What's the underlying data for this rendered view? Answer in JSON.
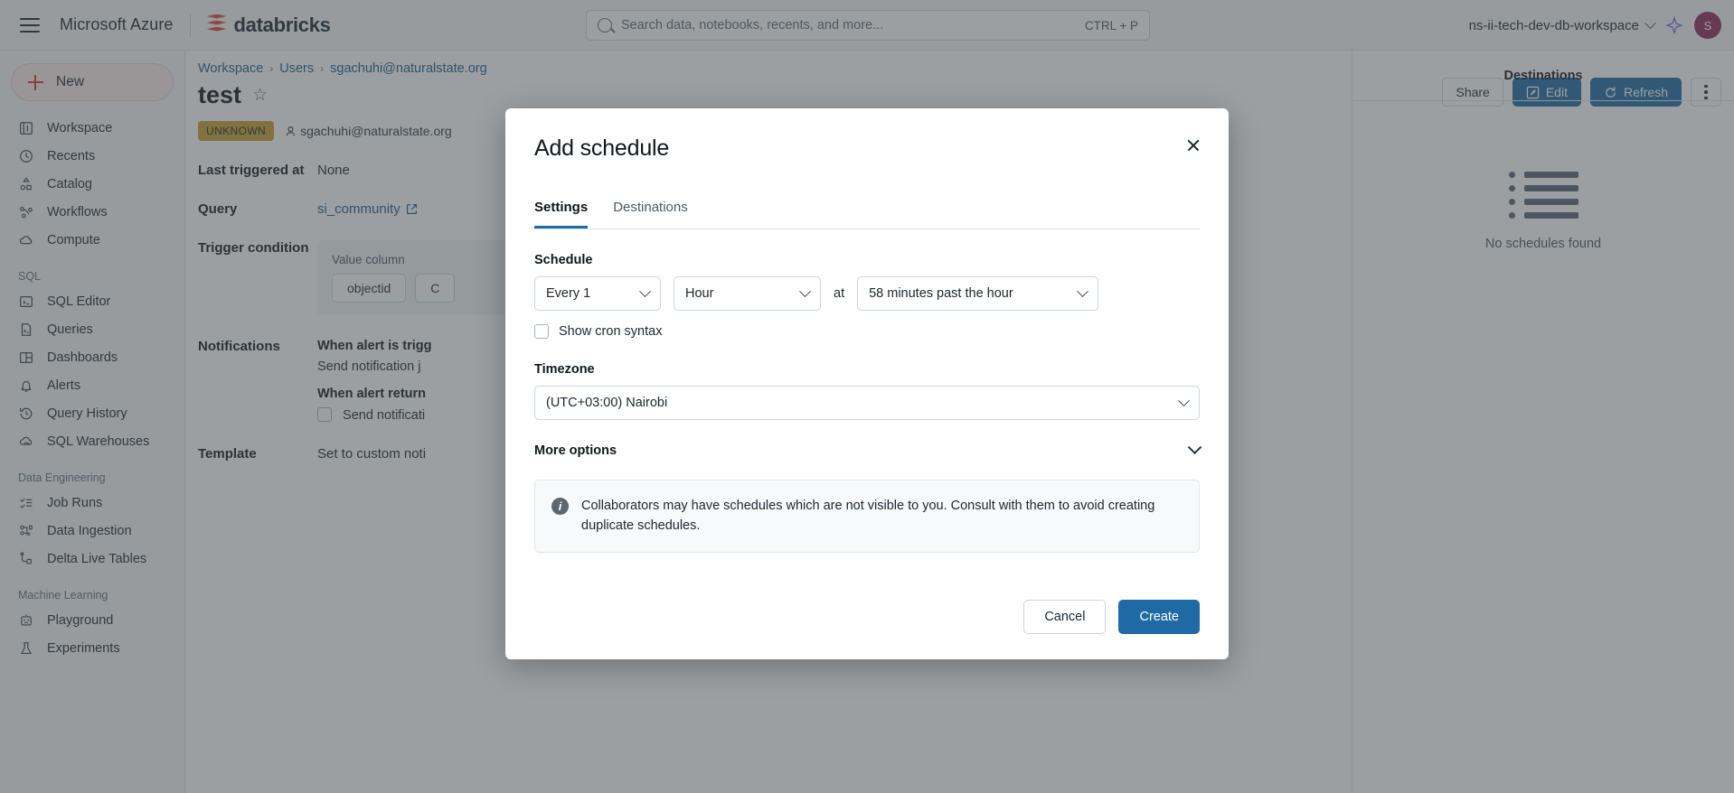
{
  "topbar": {
    "menu_icon": "hamburger-icon",
    "azure_label": "Microsoft Azure",
    "brand": "databricks",
    "search": {
      "placeholder": "Search data, notebooks, recents, and more...",
      "shortcut": "CTRL + P",
      "icon": "search-icon"
    },
    "workspace": "ns-ii-tech-dev-db-workspace",
    "assistant_icon": "sparkle-icon",
    "avatar_initial": "S"
  },
  "sidebar": {
    "new_label": "New",
    "items": [
      {
        "label": "Workspace",
        "icon": "workspace-icon"
      },
      {
        "label": "Recents",
        "icon": "clock-icon"
      },
      {
        "label": "Catalog",
        "icon": "catalog-icon"
      },
      {
        "label": "Workflows",
        "icon": "workflows-icon"
      },
      {
        "label": "Compute",
        "icon": "cloud-icon"
      }
    ],
    "sections": [
      {
        "title": "SQL",
        "items": [
          {
            "label": "SQL Editor",
            "icon": "sql-editor-icon"
          },
          {
            "label": "Queries",
            "icon": "query-file-icon"
          },
          {
            "label": "Dashboards",
            "icon": "dashboard-grid-icon"
          },
          {
            "label": "Alerts",
            "icon": "bell-icon"
          },
          {
            "label": "Query History",
            "icon": "history-icon"
          },
          {
            "label": "SQL Warehouses",
            "icon": "warehouse-icon"
          }
        ]
      },
      {
        "title": "Data Engineering",
        "items": [
          {
            "label": "Job Runs",
            "icon": "job-runs-icon"
          },
          {
            "label": "Data Ingestion",
            "icon": "data-ingestion-icon"
          },
          {
            "label": "Delta Live Tables",
            "icon": "delta-live-tables-icon"
          }
        ]
      },
      {
        "title": "Machine Learning",
        "items": [
          {
            "label": "Playground",
            "icon": "robot-icon"
          },
          {
            "label": "Experiments",
            "icon": "experiments-icon"
          }
        ]
      }
    ]
  },
  "page": {
    "breadcrumb": [
      "Workspace",
      "Users",
      "sgachuhi@naturalstate.org"
    ],
    "breadcrumb_separator": "›",
    "title": "test",
    "favorite_icon": "star-icon",
    "status_badge": "UNKNOWN",
    "owner": "sgachuhi@naturalstate.org",
    "actions": {
      "share": "Share",
      "edit": "Edit",
      "refresh": "Refresh",
      "more_icon": "kebab-menu-icon"
    },
    "details": [
      {
        "label": "Last triggered at",
        "value": "None"
      },
      {
        "label": "Query",
        "value": "si_community"
      },
      {
        "label": "Trigger condition",
        "value": ""
      },
      {
        "label": "Notifications",
        "value": ""
      },
      {
        "label": "Template",
        "value": "Set to custom noti"
      }
    ],
    "trigger": {
      "value_column_label": "Value column",
      "chips": [
        "objectid",
        "C"
      ]
    },
    "notifications": {
      "triggered_title": "When alert is trigg",
      "triggered_sub": "Send notification j",
      "returns_title": "When alert return",
      "returns_checkbox_label": "Send notificati"
    }
  },
  "right_panel": {
    "header": "Destinations",
    "empty_text": "No schedules found"
  },
  "modal": {
    "title": "Add schedule",
    "close_icon": "close-icon",
    "tabs": [
      {
        "label": "Settings",
        "active": true
      },
      {
        "label": "Destinations",
        "active": false
      }
    ],
    "schedule_label": "Schedule",
    "every": "Every 1",
    "unit": "Hour",
    "at_label": "at",
    "at_value": "58 minutes past the hour",
    "cron_label": "Show cron syntax",
    "cron_checked": false,
    "timezone_label": "Timezone",
    "timezone_value": "(UTC+03:00) Nairobi",
    "more_options_label": "More options",
    "info_icon": "info-icon",
    "info_text": "Collaborators may have schedules which are not visible to you. Consult with them to avoid creating duplicate schedules.",
    "cancel_label": "Cancel",
    "create_label": "Create"
  },
  "colors": {
    "accent_blue": "#1f6aa5",
    "brand_red": "#e03e2f",
    "badge_yellow": "#c8a035",
    "avatar_maroon": "#8c2a58"
  }
}
